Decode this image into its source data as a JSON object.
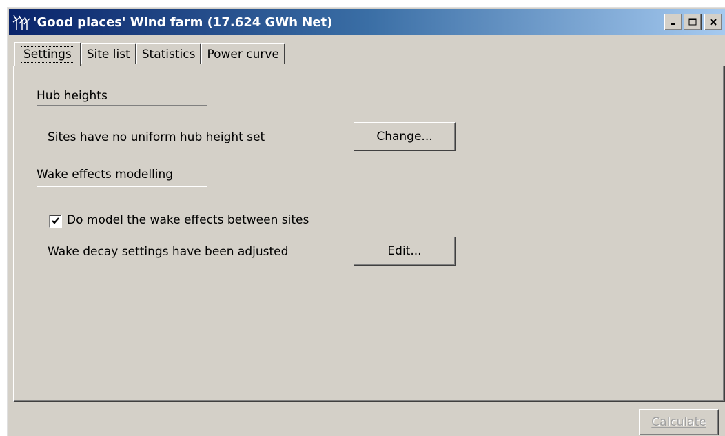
{
  "window": {
    "title": "'Good places' Wind farm (17.624 GWh Net)",
    "icon": "wind-farm-icon"
  },
  "tabs": [
    {
      "label": "Settings",
      "active": true
    },
    {
      "label": "Site list",
      "active": false
    },
    {
      "label": "Statistics",
      "active": false
    },
    {
      "label": "Power curve",
      "active": false
    }
  ],
  "hub": {
    "heading": "Hub heights",
    "status": "Sites have no uniform hub height set",
    "button": "Change..."
  },
  "wake": {
    "heading": "Wake effects modelling",
    "checkbox_label": "Do model the wake effects between sites",
    "checked": true,
    "status": "Wake decay settings have been adjusted",
    "button": "Edit..."
  },
  "footer": {
    "calculate_label": "Calculate",
    "calculate_enabled": false
  },
  "colors": {
    "face": "#d4d0c8",
    "titlebar_start": "#0a246a",
    "titlebar_end": "#a6caf0",
    "disabled_text": "#a0a0a0"
  }
}
